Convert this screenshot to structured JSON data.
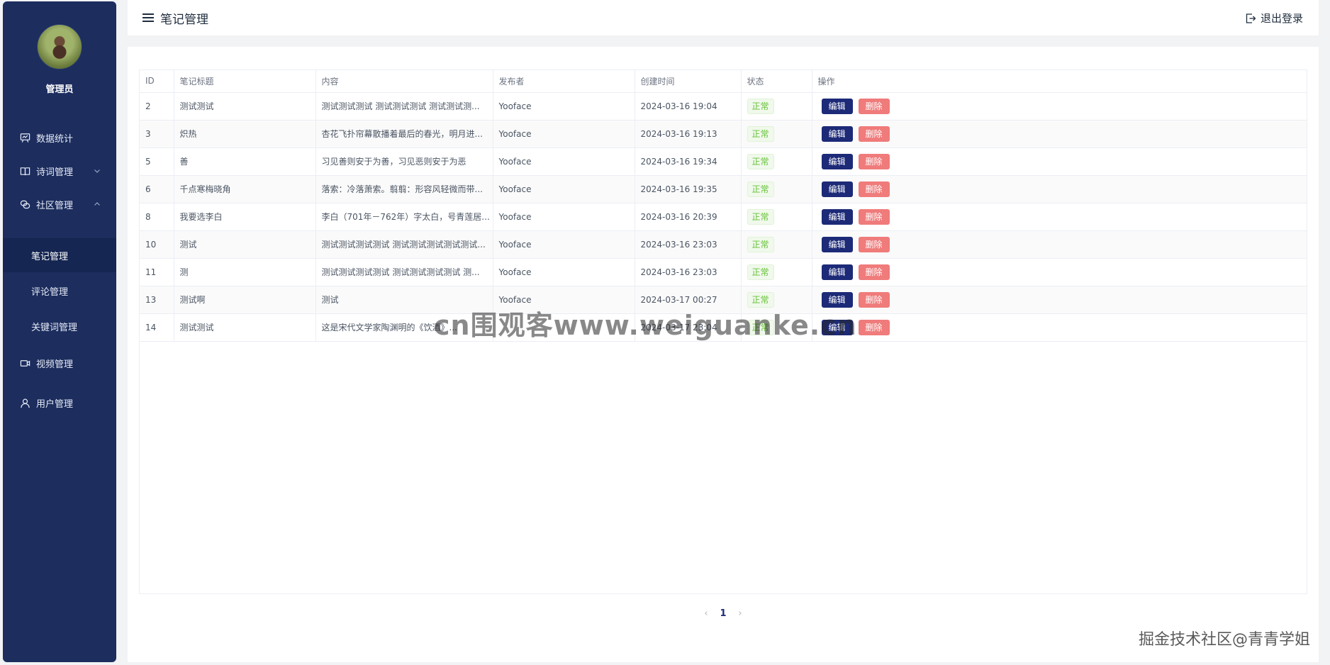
{
  "sidebar": {
    "admin_name": "管理员",
    "menu": [
      {
        "label": "数据统计",
        "icon": "chart-board-icon"
      },
      {
        "label": "诗词管理",
        "icon": "book-icon",
        "expanded": false
      },
      {
        "label": "社区管理",
        "icon": "community-icon",
        "expanded": true
      },
      {
        "label": "视频管理",
        "icon": "video-icon"
      },
      {
        "label": "用户管理",
        "icon": "user-icon"
      }
    ],
    "submenu": [
      {
        "label": "笔记管理",
        "active": true
      },
      {
        "label": "评论管理"
      },
      {
        "label": "关键词管理"
      }
    ]
  },
  "header": {
    "title": "笔记管理",
    "logout_label": "退出登录"
  },
  "table": {
    "columns": [
      "ID",
      "笔记标题",
      "内容",
      "发布者",
      "创建时间",
      "状态",
      "操作"
    ],
    "rows": [
      {
        "id": "2",
        "title": "测试测试",
        "content": "测试测试测试 测试测试测试 测试测试测...",
        "author": "Yooface",
        "created": "2024-03-16 19:04",
        "status": "正常"
      },
      {
        "id": "3",
        "title": "炽热",
        "content": "杏花飞扑帘幕散播着最后的春光，明月进...",
        "author": "Yooface",
        "created": "2024-03-16 19:13",
        "status": "正常"
      },
      {
        "id": "5",
        "title": "善",
        "content": "习见善则安于为善，习见恶则安于为恶",
        "author": "Yooface",
        "created": "2024-03-16 19:34",
        "status": "正常"
      },
      {
        "id": "6",
        "title": "千点寒梅晓角",
        "content": "落索：冷落萧索。翦翦：形容风轻微而带...",
        "author": "Yooface",
        "created": "2024-03-16 19:35",
        "status": "正常"
      },
      {
        "id": "8",
        "title": "我要选李白",
        "content": "李白（701年－762年）字太白，号青莲居...",
        "author": "Yooface",
        "created": "2024-03-16 20:39",
        "status": "正常"
      },
      {
        "id": "10",
        "title": "测试",
        "content": "测试测试测试测试 测试测试测试测试测试...",
        "author": "Yooface",
        "created": "2024-03-16 23:03",
        "status": "正常"
      },
      {
        "id": "11",
        "title": "测",
        "content": "测试测试测试测试 测试测试测试测试 测...",
        "author": "Yooface",
        "created": "2024-03-16 23:03",
        "status": "正常"
      },
      {
        "id": "13",
        "title": "测试啊",
        "content": "测试",
        "author": "Yooface",
        "created": "2024-03-17 00:27",
        "status": "正常"
      },
      {
        "id": "14",
        "title": "测试测试",
        "content": "这是宋代文学家陶渊明的《饮酒》...",
        "author": "",
        "created": "2024-03-17 23:04",
        "status": "正常"
      }
    ],
    "edit_label": "编辑",
    "delete_label": "删除"
  },
  "pagination": {
    "current_page": "1",
    "prev_icon": "chevron-left-icon",
    "next_icon": "chevron-right-icon"
  },
  "watermarks": {
    "center": "cn围观客www.weiguanke.cn",
    "corner": "掘金技术社区@青青学姐"
  },
  "colors": {
    "sidebar_bg": "#1c2d5e",
    "sidebar_active": "#162652",
    "edit_button": "#1c2a78",
    "delete_button": "#f07b7b",
    "status_green": "#67c23a"
  }
}
